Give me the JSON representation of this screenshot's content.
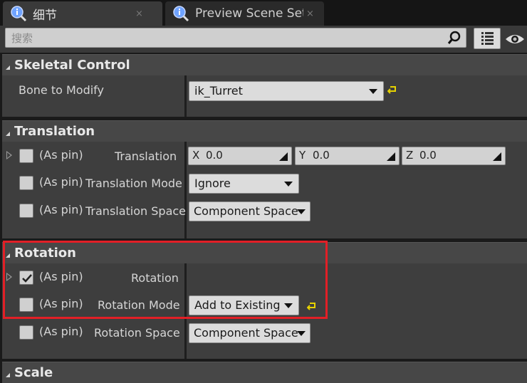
{
  "tabs": [
    {
      "label": "细节",
      "icon": "details-info-icon",
      "close": "×",
      "active": true
    },
    {
      "label": "Preview Scene Sett",
      "icon": "preview-info-icon",
      "close": "×",
      "active": false
    }
  ],
  "search": {
    "placeholder": "搜索",
    "icon": "search-icon"
  },
  "toolbar": {
    "view_options_icon": "view-options-icon",
    "visibility_icon": "eye-icon"
  },
  "sections": {
    "skeletal_control": {
      "title": "Skeletal Control",
      "bone_label": "Bone to Modify",
      "bone_value": "ik_Turret"
    },
    "translation": {
      "title": "Translation",
      "rows": [
        {
          "pin": "(As pin)",
          "label": "Translation",
          "checked": false
        },
        {
          "pin": "(As pin)",
          "label": "Translation Mode",
          "checked": false
        },
        {
          "pin": "(As pin)",
          "label": "Translation Space",
          "checked": false
        }
      ],
      "vector": [
        {
          "axis": "X",
          "value": "0.0"
        },
        {
          "axis": "Y",
          "value": "0.0"
        },
        {
          "axis": "Z",
          "value": "0.0"
        }
      ],
      "mode_value": "Ignore",
      "space_value": "Component Space"
    },
    "rotation": {
      "title": "Rotation",
      "rows": [
        {
          "pin": "(As pin)",
          "label": "Rotation",
          "checked": true
        },
        {
          "pin": "(As pin)",
          "label": "Rotation Mode",
          "checked": false
        },
        {
          "pin": "(As pin)",
          "label": "Rotation Space",
          "checked": false
        }
      ],
      "mode_value": "Add to Existing",
      "space_value": "Component Space"
    },
    "scale": {
      "title": "Scale"
    }
  },
  "colors": {
    "highlight": "#e21f26",
    "reset_arrow": "#e6d200"
  }
}
